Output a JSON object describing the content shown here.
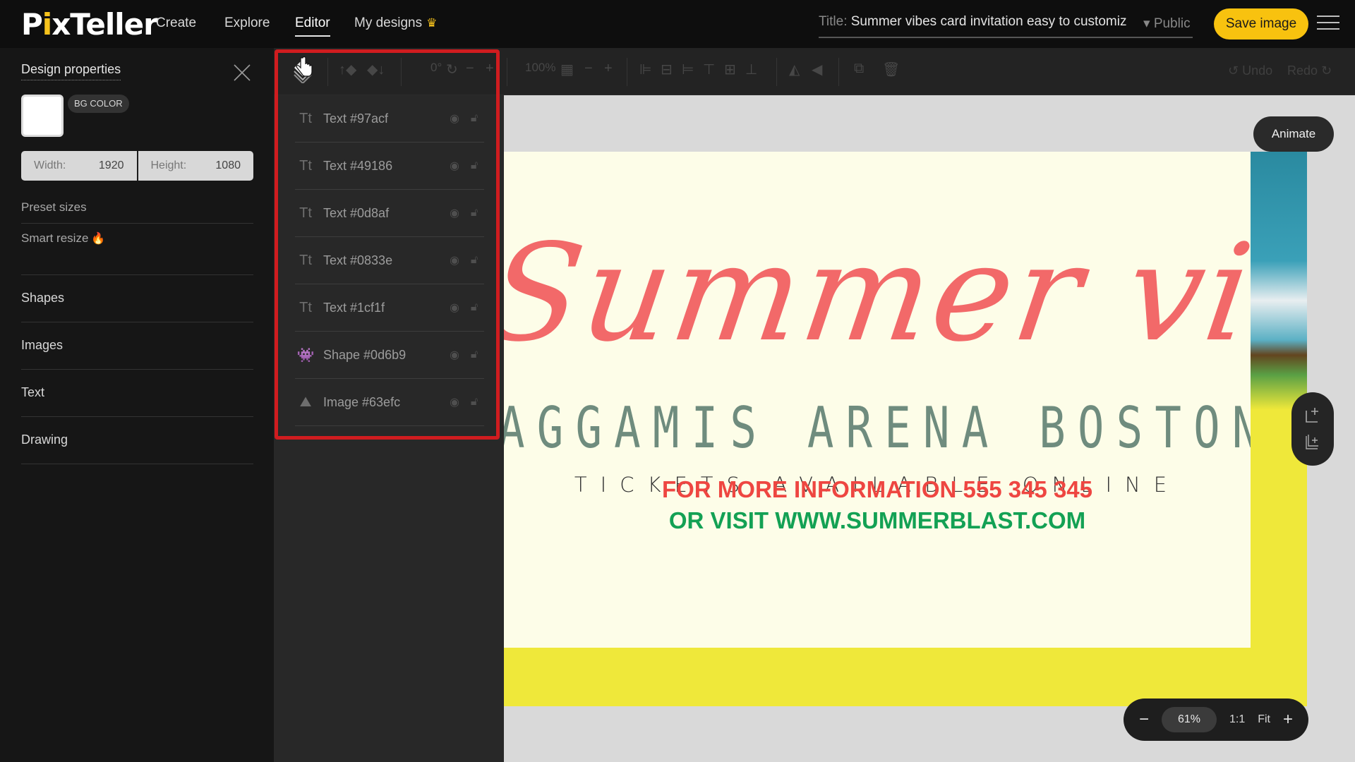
{
  "header": {
    "logo": {
      "prefix": "P",
      "dot": "i",
      "suffix": "xTeller"
    },
    "nav": [
      {
        "label": "Create"
      },
      {
        "label": "Explore"
      },
      {
        "label": "Editor",
        "active": true
      },
      {
        "label": "My designs",
        "badge_icon": "crown-icon"
      }
    ],
    "title_label": "Title:",
    "title_value": "Summer vibes card invitation easy to customiz",
    "visibility": "▾ Public",
    "save_label": "Save image"
  },
  "sidebar": {
    "title": "Design properties",
    "bg_color_label": "BG COLOR",
    "bg_color": "#ffffff",
    "width_label": "Width:",
    "width_value": "1920",
    "height_label": "Height:",
    "height_value": "1080",
    "preset_sizes": "Preset sizes",
    "smart_resize": "Smart resize",
    "sections": [
      {
        "label": "Shapes"
      },
      {
        "label": "Images"
      },
      {
        "label": "Text"
      },
      {
        "label": "Drawing"
      }
    ]
  },
  "toolbar": {
    "rotation": "0°",
    "opacity": "100%",
    "undo": "Undo",
    "redo": "Redo"
  },
  "layers": [
    {
      "type": "text",
      "icon": "text-layer-icon",
      "name": "Text #97acf"
    },
    {
      "type": "text",
      "icon": "text-layer-icon",
      "name": "Text #49186"
    },
    {
      "type": "text",
      "icon": "text-layer-icon",
      "name": "Text #0d8af"
    },
    {
      "type": "text",
      "icon": "text-layer-icon",
      "name": "Text #0833e"
    },
    {
      "type": "text",
      "icon": "text-layer-icon",
      "name": "Text #1cf1f"
    },
    {
      "type": "shape",
      "icon": "shape-layer-icon",
      "name": "Shape #0d6b9"
    },
    {
      "type": "image",
      "icon": "image-layer-icon",
      "name": "Image #63efc"
    }
  ],
  "design": {
    "title": "Summer vibes",
    "venue": "AGGAMIS ARENA BOSTON",
    "tickets": "TICKETS AVAILABLE ONLINE",
    "info": "FOR MORE INFORMATION 555 345 345",
    "visit": "OR VISIT WWW.SUMMERBLAST.COM",
    "colors": {
      "card": "#fdfde8",
      "title": "#f15a5c",
      "info": "#ee4641",
      "visit": "#13a154",
      "strip": "#efe83a"
    }
  },
  "canvas": {
    "animate_label": "Animate",
    "zoom_value": "61%",
    "zoom_ratio": "1:1",
    "zoom_fit": "Fit",
    "zoom_minus": "−",
    "zoom_plus": "+"
  },
  "colors": {
    "accent": "#f8c20f",
    "highlight": "#d01c1f"
  }
}
